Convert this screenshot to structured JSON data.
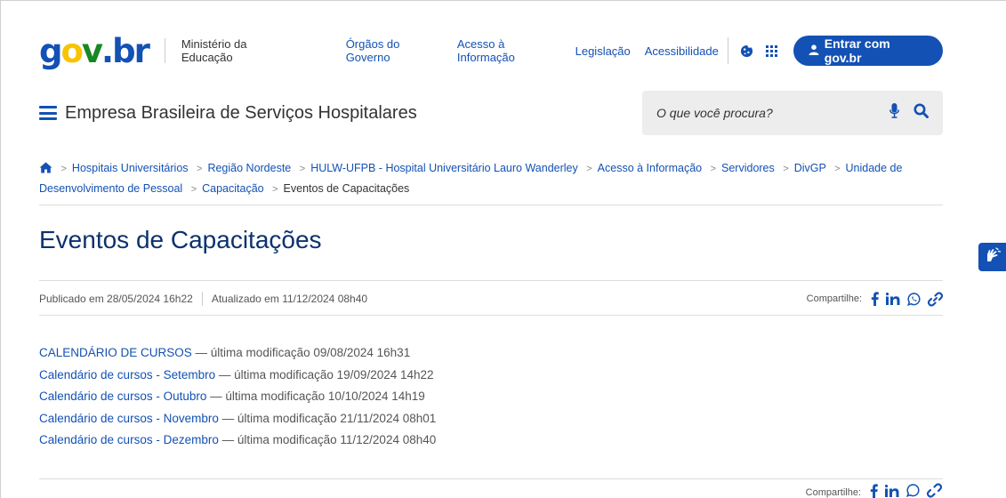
{
  "header": {
    "logo": {
      "g": "g",
      "o": "o",
      "v": "v",
      "dot": ".",
      "br": "br"
    },
    "ministry": "Ministério da Educação",
    "links": [
      "Órgãos do Governo",
      "Acesso à Informação",
      "Legislação",
      "Acessibilidade"
    ],
    "login_label": "Entrar com gov.br",
    "site_name": "Empresa Brasileira de Serviços Hospitalares",
    "search_placeholder": "O que você procura?"
  },
  "breadcrumb": {
    "items": [
      "Hospitais Universitários",
      "Região Nordeste",
      "HULW-UFPB - Hospital Universitário Lauro Wanderley",
      "Acesso à Informação",
      "Servidores",
      "DivGP",
      "Unidade de Desenvolvimento de Pessoal",
      "Capacitação"
    ],
    "current": "Eventos de Capacitações",
    "separator": ">"
  },
  "page": {
    "title": "Eventos de Capacitações",
    "published": "Publicado em 28/05/2024 16h22",
    "updated": "Atualizado em 11/12/2024 08h40",
    "share_label": "Compartilhe:"
  },
  "files": [
    {
      "name": "CALENDÁRIO DE CURSOS",
      "modified": " — última modificação 09/08/2024 16h31"
    },
    {
      "name": "Calendário de cursos - Setembro",
      "modified": " — última modificação 19/09/2024 14h22"
    },
    {
      "name": "Calendário de cursos - Outubro",
      "modified": " — última modificação 10/10/2024 14h19"
    },
    {
      "name": "Calendário de cursos - Novembro",
      "modified": " — última modificação 21/11/2024 08h01"
    },
    {
      "name": "Calendário de cursos - Dezembro",
      "modified": " — última modificação 11/12/2024 08h40"
    }
  ],
  "icons": {
    "share": [
      "facebook-icon",
      "linkedin-icon",
      "whatsapp-icon",
      "link-icon"
    ],
    "header": [
      "cookie-icon",
      "apps-grid-icon",
      "user-icon",
      "microphone-icon",
      "search-icon",
      "home-icon",
      "sign-language-icon",
      "menu-icon"
    ]
  },
  "colors": {
    "primary": "#1351b4",
    "title": "#0c326f",
    "gov_yellow": "#f8c300",
    "gov_green": "#168821"
  }
}
